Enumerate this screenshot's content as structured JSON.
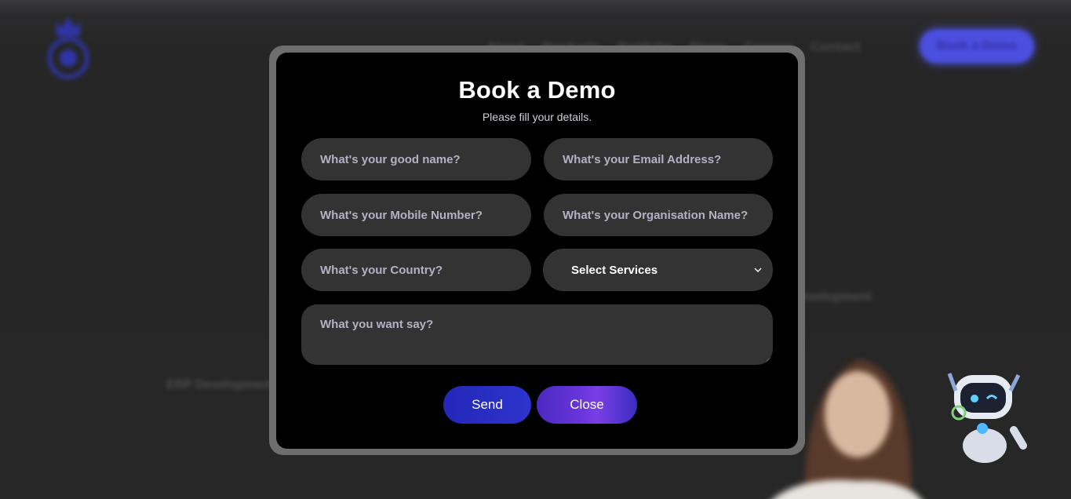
{
  "background": {
    "nav_items": [
      "About",
      "Products",
      "Portfolio",
      "Blogs",
      "Careers",
      "Contact"
    ],
    "nav_cta": "Book a Demo",
    "text_right": "Development",
    "text_left": "ERP Development"
  },
  "modal": {
    "title": "Book a Demo",
    "subtitle": "Please fill your details.",
    "fields": {
      "name_placeholder": "What's your good name?",
      "email_placeholder": "What's your Email Address?",
      "mobile_placeholder": "What's your Mobile Number?",
      "organisation_placeholder": "What's your Organisation Name?",
      "country_placeholder": "What's your Country?",
      "services_selected": "Select Services",
      "message_placeholder": "What you want say?"
    },
    "buttons": {
      "send": "Send",
      "close": "Close"
    }
  },
  "colors": {
    "modal_bg": "#000000",
    "field_bg": "#333334",
    "send_button": "#2327b8",
    "close_button": "#6a35dd",
    "accent_blue": "#4b4fe0"
  }
}
